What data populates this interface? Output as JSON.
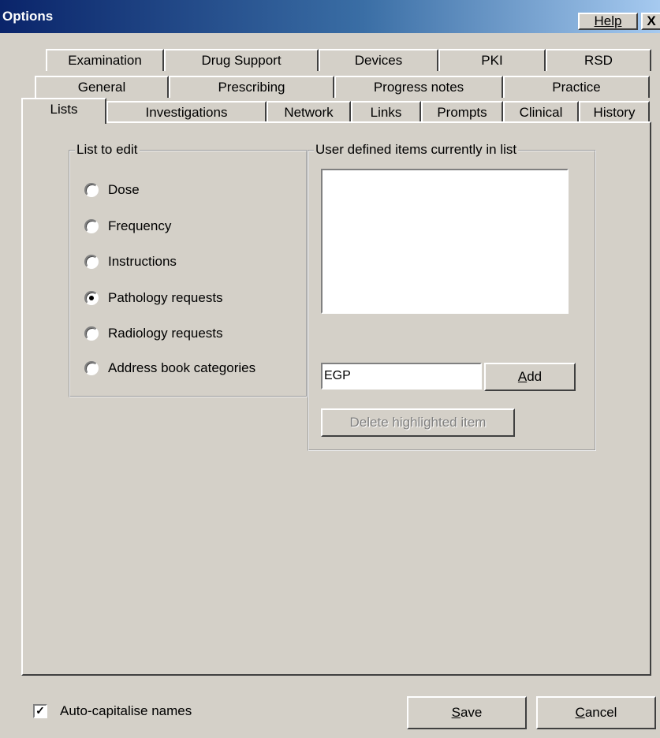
{
  "window": {
    "title": "Options",
    "help_label": "Help",
    "close_label": "X"
  },
  "tabs": {
    "row1": [
      "Examination",
      "Drug Support",
      "Devices",
      "PKI",
      "RSD"
    ],
    "row2": [
      "General",
      "Prescribing",
      "Progress notes",
      "Practice"
    ],
    "row3": [
      "Lists",
      "Investigations",
      "Network",
      "Links",
      "Prompts",
      "Clinical",
      "History"
    ],
    "active": "Lists"
  },
  "list_to_edit": {
    "legend": "List to edit",
    "options": [
      "Dose",
      "Frequency",
      "Instructions",
      "Pathology requests",
      "Radiology requests",
      "Address book categories"
    ],
    "selected": "Pathology requests"
  },
  "user_items": {
    "legend": "User defined items currently in list",
    "items": [],
    "entry_value": "EGP",
    "add_label": "Add",
    "add_mnemonic": "A",
    "delete_label": "Delete highlighted item"
  },
  "footer": {
    "auto_capitalise_label": "Auto-capitalise names",
    "auto_capitalise_checked": true,
    "save_label": "Save",
    "cancel_label": "Cancel"
  }
}
